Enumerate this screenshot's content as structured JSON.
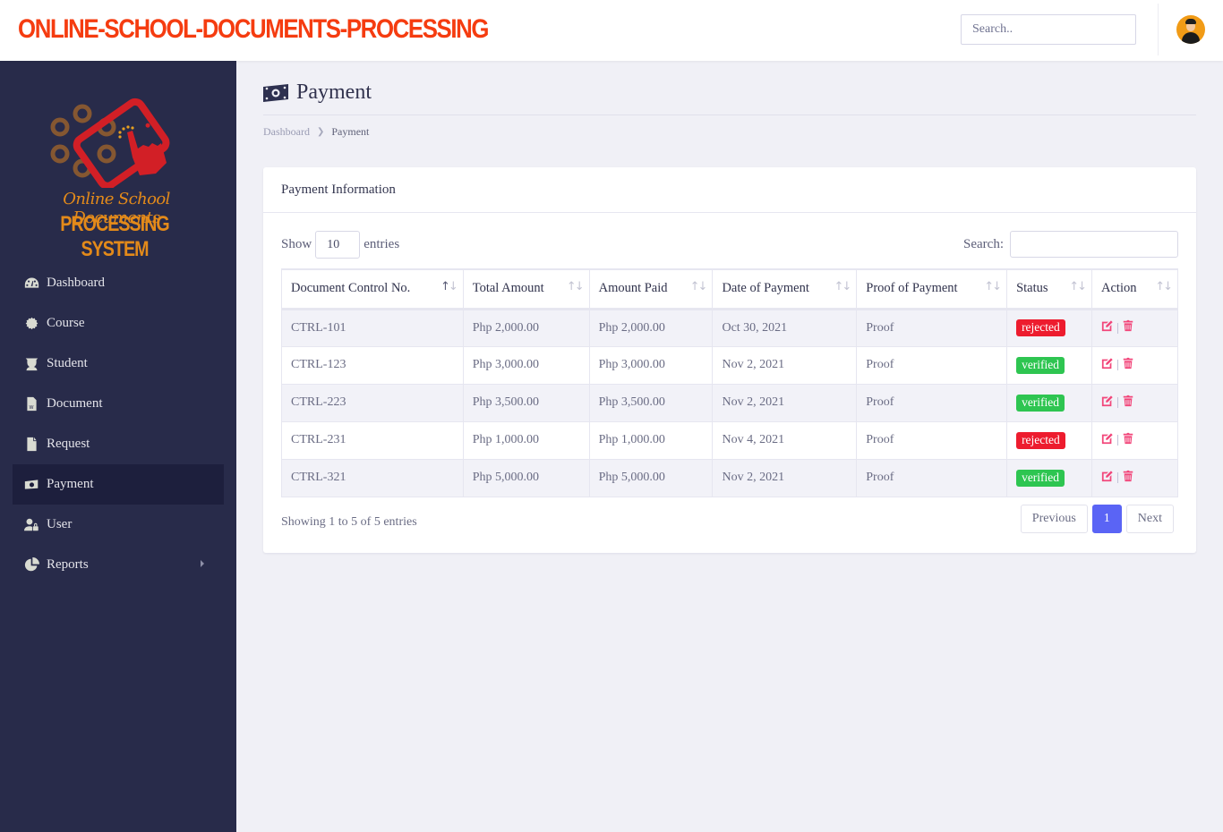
{
  "header": {
    "brand": "ONLINE-SCHOOL-DOCUMENTS-PROCESSING",
    "search_placeholder": "Search..",
    "avatar_icon": "user-avatar-icon"
  },
  "sidebar": {
    "logo": {
      "line1": "Online School Documents",
      "line2": "PROCESSING SYSTEM"
    },
    "items": [
      {
        "label": "Dashboard",
        "icon": "tachometer-icon",
        "active": false
      },
      {
        "label": "Course",
        "icon": "gear-badge-icon",
        "active": false
      },
      {
        "label": "Student",
        "icon": "graduate-icon",
        "active": false
      },
      {
        "label": "Document",
        "icon": "word-file-icon",
        "active": false
      },
      {
        "label": "Request",
        "icon": "file-icon",
        "active": false
      },
      {
        "label": "Payment",
        "icon": "money-bill-icon",
        "active": true
      },
      {
        "label": "User",
        "icon": "user-lock-icon",
        "active": false
      },
      {
        "label": "Reports",
        "icon": "pie-chart-icon",
        "active": false,
        "has_submenu": true
      }
    ]
  },
  "page": {
    "title": "Payment",
    "title_icon": "money-bill-icon",
    "breadcrumb": [
      {
        "label": "Dashboard",
        "link": true
      },
      {
        "label": "Payment",
        "link": false
      }
    ]
  },
  "card": {
    "title": "Payment Information",
    "length": {
      "show_label": "Show",
      "value": "10",
      "entries_label": "entries"
    },
    "filter": {
      "label": "Search:",
      "value": ""
    },
    "columns": [
      "Document Control No.",
      "Total Amount",
      "Amount Paid",
      "Date of Payment",
      "Proof of Payment",
      "Status",
      "Action"
    ],
    "rows": [
      {
        "control_no": "CTRL-101",
        "total": "Php 2,000.00",
        "paid": "Php 2,000.00",
        "date": "Oct 30, 2021",
        "proof": "Proof",
        "status": "rejected"
      },
      {
        "control_no": "CTRL-123",
        "total": "Php 3,000.00",
        "paid": "Php 3,000.00",
        "date": "Nov 2, 2021",
        "proof": "Proof",
        "status": "verified"
      },
      {
        "control_no": "CTRL-223",
        "total": "Php 3,500.00",
        "paid": "Php 3,500.00",
        "date": "Nov 2, 2021",
        "proof": "Proof",
        "status": "verified"
      },
      {
        "control_no": "CTRL-231",
        "total": "Php 1,000.00",
        "paid": "Php 1,000.00",
        "date": "Nov 4, 2021",
        "proof": "Proof",
        "status": "rejected"
      },
      {
        "control_no": "CTRL-321",
        "total": "Php 5,000.00",
        "paid": "Php 5,000.00",
        "date": "Nov 2, 2021",
        "proof": "Proof",
        "status": "verified"
      }
    ],
    "info": "Showing 1 to 5 of 5 entries",
    "pagination": {
      "previous": "Previous",
      "current": "1",
      "next": "Next"
    }
  },
  "colors": {
    "brand": "#f53c10",
    "sidebar_bg": "#282b4a",
    "sidebar_active": "#1d1f3d",
    "rejected": "#ed1c2e",
    "verified": "#2ec551",
    "action_icons": "#f2467a",
    "page_active": "#5a64f5",
    "logo_orange": "#e38a1a"
  }
}
